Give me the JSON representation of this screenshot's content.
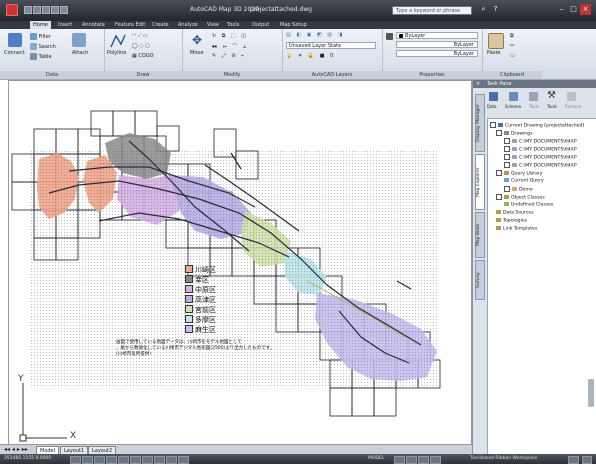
{
  "titlebar": {
    "app_title": "AutoCAD Map 3D 2010",
    "file_name": "projectattached.dwg",
    "search_placeholder": "Type a keyword or phrase"
  },
  "menu": {
    "tabs": [
      "Home",
      "Insert",
      "Annotate",
      "Feature Edit",
      "Create",
      "Analyze",
      "View",
      "Tools",
      "Output",
      "Map Setup"
    ]
  },
  "ribbon": {
    "data_panel": {
      "label": "Data",
      "connect": "Connect",
      "filter": "Filter",
      "search": "Search",
      "table": "Table",
      "attach": "Attach"
    },
    "draw_panel": {
      "label": "Draw",
      "polyline": "Polyline",
      "cogo": "COGO"
    },
    "modify_panel": {
      "label": "Modify",
      "move": "Move"
    },
    "layers_panel": {
      "label": "AutoCAD Layers",
      "layer_state": "Unsaved Layer State"
    },
    "properties_panel": {
      "label": "Properties",
      "bylayer_color": "ByLayer",
      "bylayer_linetype": "ByLayer",
      "bylayer_lineweight": "ByLayer"
    },
    "clipboard_panel": {
      "label": "Clipboard",
      "paste": "Paste"
    }
  },
  "taskpane": {
    "title": "Task Pane",
    "toolbar": [
      "Data",
      "Schema",
      "Tools",
      "Tools",
      "Remove"
    ],
    "side_tabs": [
      "Display Manager",
      "Map Explorer",
      "Map Book",
      "Survey"
    ],
    "tree": [
      "Current Drawing [projectattached]",
      "Drawings",
      "C:\\MY DOCUMENTS\\64AP",
      "C:\\MY DOCUMENTS\\64AP",
      "C:\\MY DOCUMENTS\\64AP",
      "C:\\MY DOCUMENTS\\64AP",
      "Query Library",
      "Current Query",
      "Demo",
      "Object Classes",
      "Undefined Classes",
      "Data Sources",
      "Topologies",
      "Link Templates"
    ]
  },
  "map": {
    "legend": [
      {
        "label": "川崎区",
        "color": "#f2a58a"
      },
      {
        "label": "幸区",
        "color": "#8a8a8a"
      },
      {
        "label": "中原区",
        "color": "#d6b1e6"
      },
      {
        "label": "高津区",
        "color": "#b9aee6"
      },
      {
        "label": "宮前区",
        "color": "#cfe3a8"
      },
      {
        "label": "多摩区",
        "color": "#bfe6ea"
      },
      {
        "label": "麻生区",
        "color": "#c4c0ee"
      }
    ],
    "note_lines": [
      "画面で使用している地図データは、川崎市をモデル地図として",
      "、紙から数値化している川崎市デジタル地形図(2500)より出力したものです。",
      "(川崎市役所提供)"
    ],
    "ucs": {
      "x_label": "X",
      "y_label": "Y"
    }
  },
  "layout_tabs": [
    "Model",
    "Layout1",
    "Layout2"
  ],
  "statusbar": {
    "coords": "351485.1155 0.0000",
    "model_label": "MODEL",
    "workspace": "Tool-based Ribbon Workspace"
  }
}
